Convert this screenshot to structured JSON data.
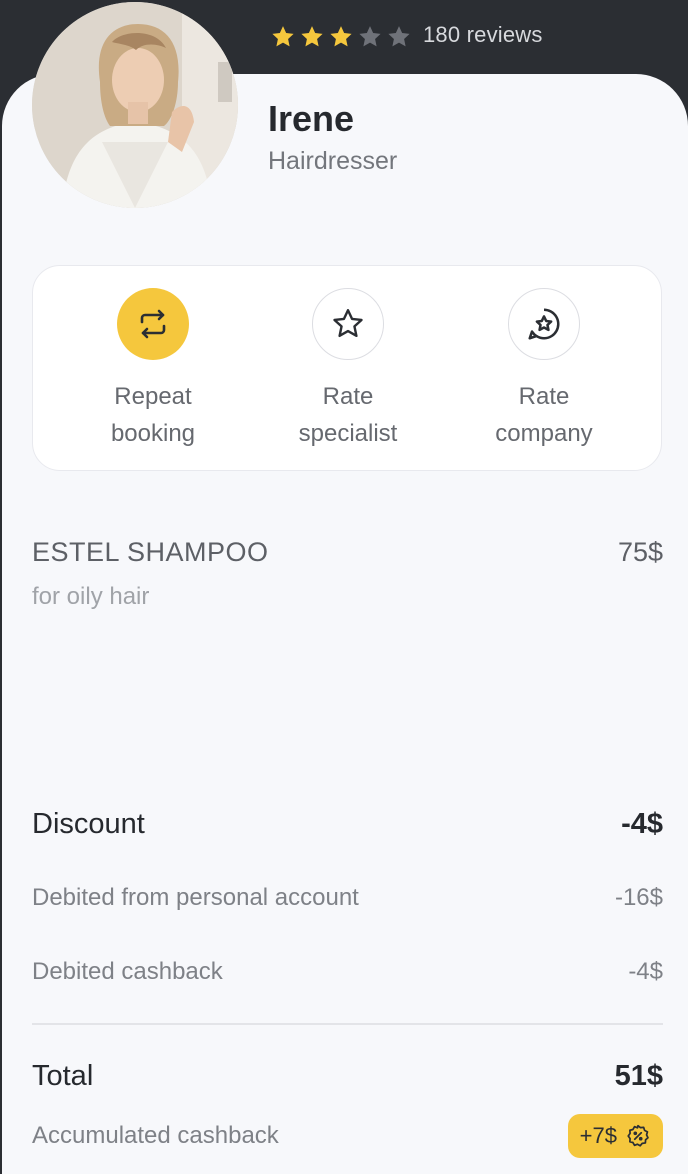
{
  "header": {
    "rating": 3,
    "max_rating": 5,
    "reviews_text": "180 reviews",
    "star_color": "#f5c73d",
    "star_empty_color": "#6f7279"
  },
  "profile": {
    "name": "Irene",
    "role": "Hairdresser",
    "avatar_icon": "avatar-photo"
  },
  "actions": [
    {
      "line1": "Repeat",
      "line2": "booking",
      "icon": "repeat-icon"
    },
    {
      "line1": "Rate",
      "line2": "specialist",
      "icon": "star-icon"
    },
    {
      "line1": "Rate",
      "line2": "company",
      "icon": "chat-star-icon"
    }
  ],
  "product": {
    "name": "ESTEL SHAMPOO",
    "description": "for oily hair",
    "price": "75$"
  },
  "summary": {
    "discount_label": "Discount",
    "discount_value": "-4$",
    "debit_account_label": "Debited from personal account",
    "debit_account_value": "-16$",
    "debit_cashback_label": "Debited cashback",
    "debit_cashback_value": "-4$",
    "total_label": "Total",
    "total_value": "51$",
    "cashback_label": "Accumulated cashback",
    "cashback_badge": "+7$",
    "cashback_icon": "percent-badge-icon"
  },
  "colors": {
    "accent": "#f5c73d",
    "dark": "#2b2e33",
    "background": "#f7f8fb"
  }
}
